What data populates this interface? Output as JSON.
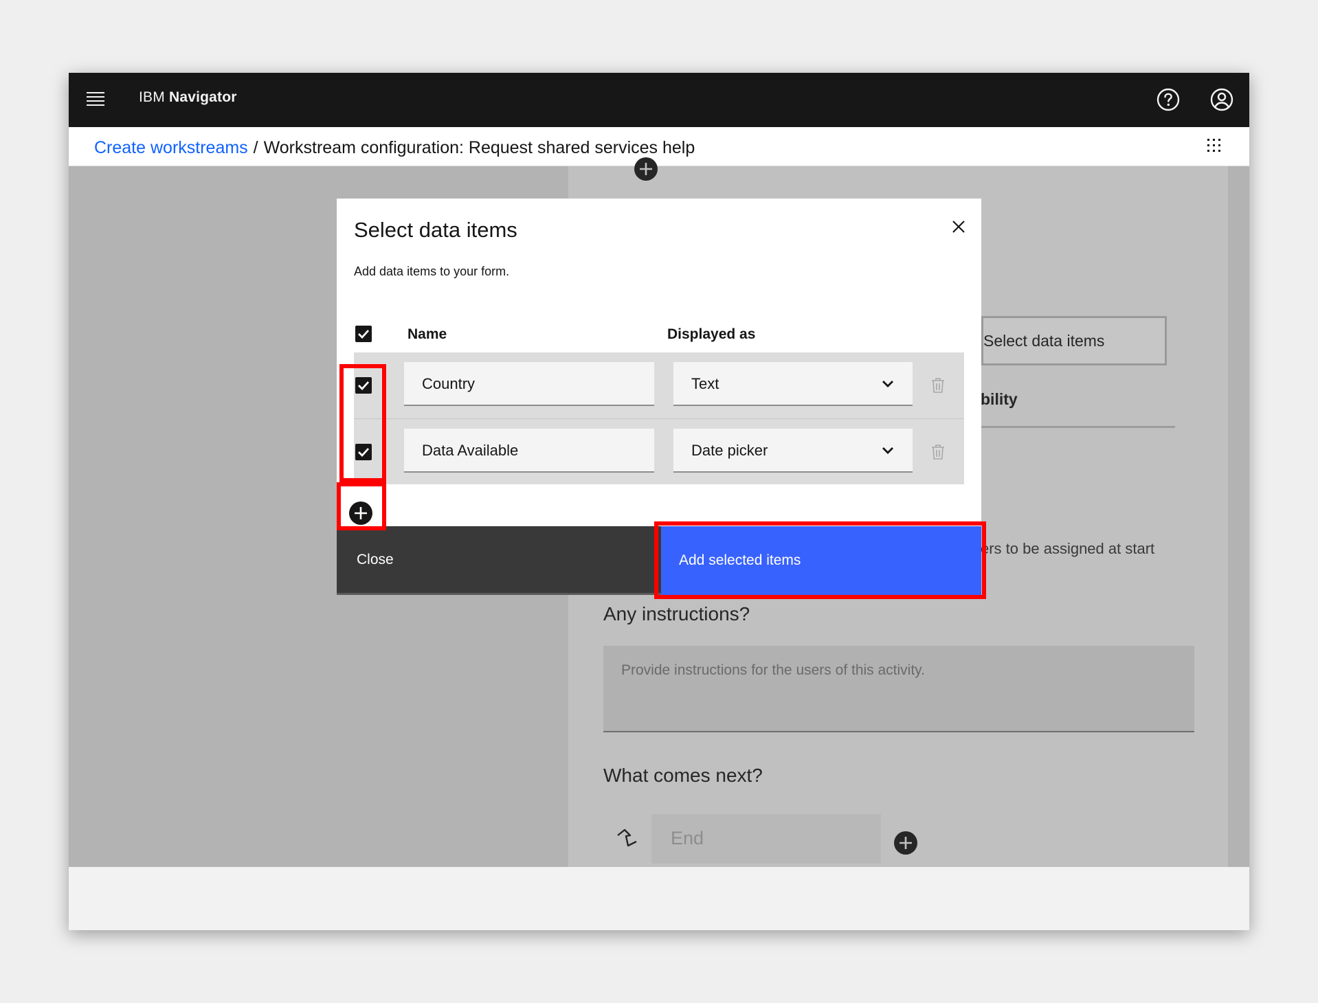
{
  "header": {
    "brand_prefix": "IBM",
    "brand_name": "Navigator",
    "help_icon": "help-circle-icon",
    "user_icon": "user-avatar-icon"
  },
  "breadcrumb": {
    "link": "Create workstreams",
    "separator": "/",
    "current": "Workstream configuration: Request shared services help"
  },
  "background": {
    "select_data_items_label": "Select data items",
    "visibility_fragment": "bility",
    "assigned_fragment": "ers to be assigned at start",
    "instructions_heading": "Any instructions?",
    "instructions_placeholder": "Provide instructions for the users of this activity.",
    "next_heading": "What comes next?",
    "next_value": "End"
  },
  "modal": {
    "title": "Select data items",
    "subtitle": "Add data items to your form.",
    "columns": {
      "name": "Name",
      "displayed_as": "Displayed as"
    },
    "rows": [
      {
        "name": "Country",
        "displayed_as": "Text",
        "checked": true
      },
      {
        "name": "Data Available",
        "displayed_as": "Date picker",
        "checked": true
      }
    ],
    "close_label": "Close",
    "add_label": "Add selected items"
  },
  "colors": {
    "header_bg": "#171717",
    "link": "#0f62fe",
    "primary_button": "#3862fe",
    "secondary_button": "#393939",
    "highlight": "#ff0000"
  }
}
